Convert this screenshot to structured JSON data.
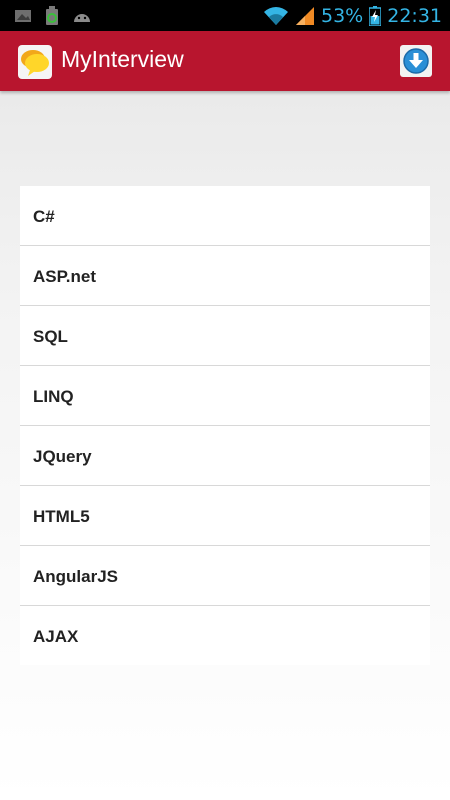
{
  "status_bar": {
    "battery_percent": "53%",
    "time": "22:31",
    "icons": [
      "image-notification-icon",
      "battery-charging-notification-icon",
      "android-icon",
      "wifi-icon",
      "signal-icon",
      "battery-icon"
    ]
  },
  "app_bar": {
    "title": "MyInterview",
    "logo_icon": "speech-bubble-icon",
    "action_icon": "download-icon"
  },
  "topics": [
    {
      "label": "C#"
    },
    {
      "label": "ASP.net"
    },
    {
      "label": "SQL"
    },
    {
      "label": "LINQ"
    },
    {
      "label": "JQuery"
    },
    {
      "label": "HTML5"
    },
    {
      "label": "AngularJS"
    },
    {
      "label": "AJAX"
    }
  ],
  "colors": {
    "app_bar": "#b8152e",
    "status_accent": "#34b5e5",
    "status_bar": "#000000"
  }
}
